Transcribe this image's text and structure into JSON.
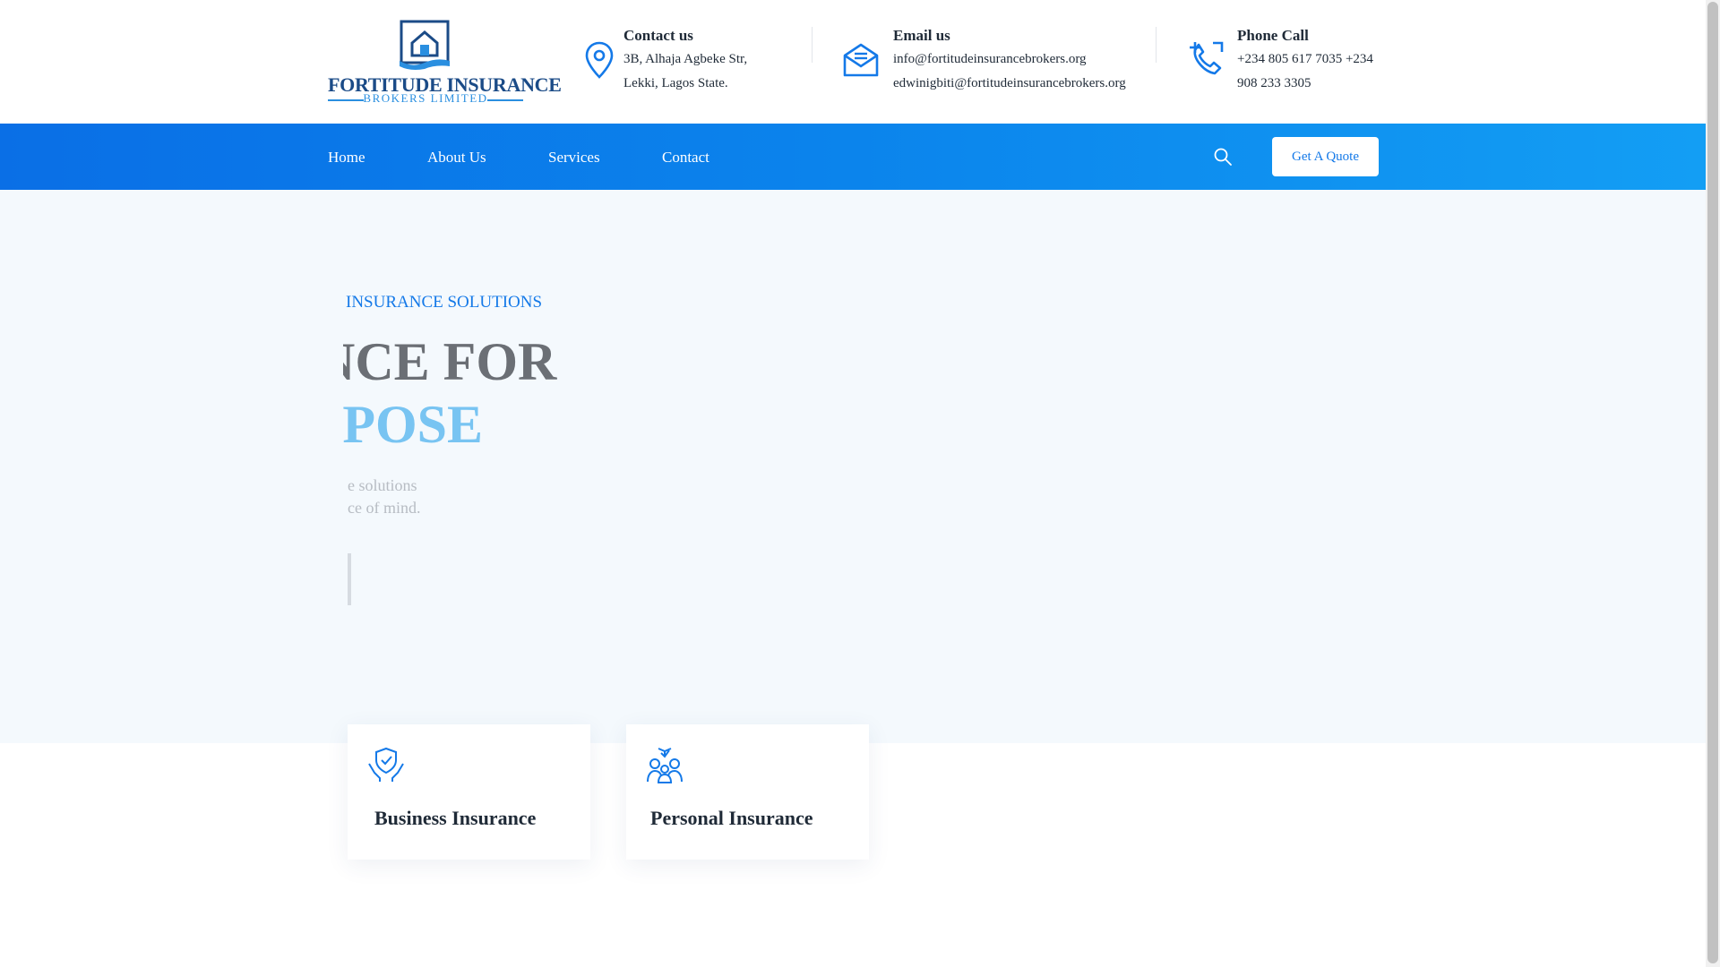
{
  "brand": {
    "name_line1": "FORTITUDE INSURANCE",
    "name_line2": "BROKERS LIMITED",
    "primary_color": "#1479e8",
    "dark_color": "#1b4b87"
  },
  "header": {
    "contact": {
      "icon": "map-pin-icon",
      "title": "Contact us",
      "lines": [
        "3B, Alhaja Agbeke Str,",
        "Lekki, Lagos State."
      ]
    },
    "email": {
      "icon": "envelope-icon",
      "title": "Email us",
      "lines": [
        "info@fortitudeinsurancebrokers.org",
        "edwinigbiti@fortitudeinsurancebrokers.org"
      ]
    },
    "phone": {
      "icon": "phone-call-icon",
      "title": "Phone Call",
      "lines": [
        "+234 805 617 7035 +234",
        "908 233 3305"
      ]
    }
  },
  "nav": {
    "items": [
      {
        "label": "Home"
      },
      {
        "label": "About Us"
      },
      {
        "label": "Services"
      },
      {
        "label": "Contact"
      }
    ],
    "search_icon": "search-icon",
    "cta_label": "Get A Quote"
  },
  "hero": {
    "eyebrow": "INSURANCE SOLUTIONS",
    "heading_line1": "NCE FOR",
    "heading_line2": "RPOSE",
    "text_line1": "e solutions",
    "text_line2": "ce of mind."
  },
  "cards": [
    {
      "icon": "shield-hands-icon",
      "title": "Business Insurance"
    },
    {
      "icon": "family-group-icon",
      "title": "Personal Insurance"
    }
  ]
}
